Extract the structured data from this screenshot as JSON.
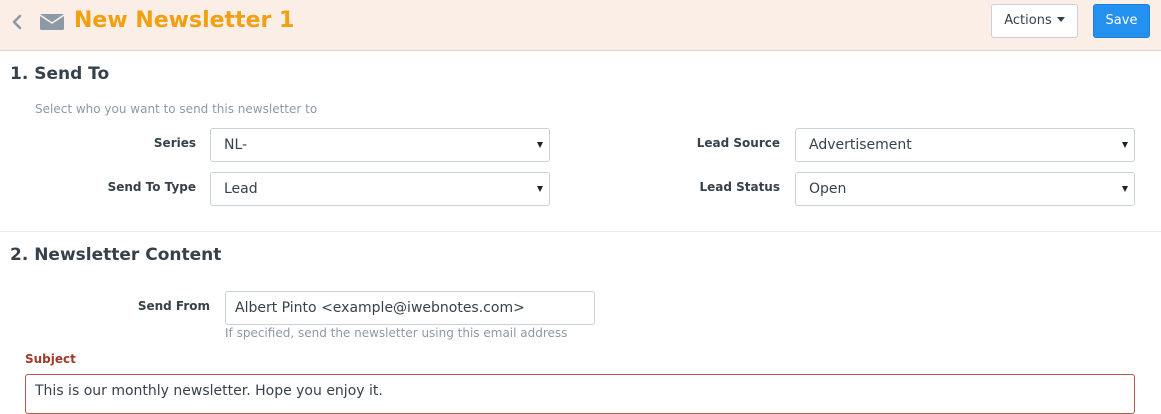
{
  "header": {
    "title": "New Newsletter 1",
    "title_color": "#f0a010",
    "back_icon": "chevron-left-icon",
    "doc_icon": "envelope-icon",
    "actions_label": "Actions",
    "save_label": "Save"
  },
  "send_to": {
    "title": "1. Send To",
    "help": "Select who you want to send this newsletter to",
    "series": {
      "label": "Series",
      "value": "NL-"
    },
    "send_to_type": {
      "label": "Send To Type",
      "value": "Lead"
    },
    "lead_source": {
      "label": "Lead Source",
      "value": "Advertisement"
    },
    "lead_status": {
      "label": "Lead Status",
      "value": "Open"
    }
  },
  "content": {
    "title": "2. Newsletter Content",
    "send_from": {
      "label": "Send From",
      "value": "Albert Pinto <example@iwebnotes.com>",
      "help": "If specified, send the newsletter using this email address"
    },
    "subject": {
      "label": "Subject",
      "value": "This is our monthly newsletter. Hope you enjoy it."
    }
  }
}
